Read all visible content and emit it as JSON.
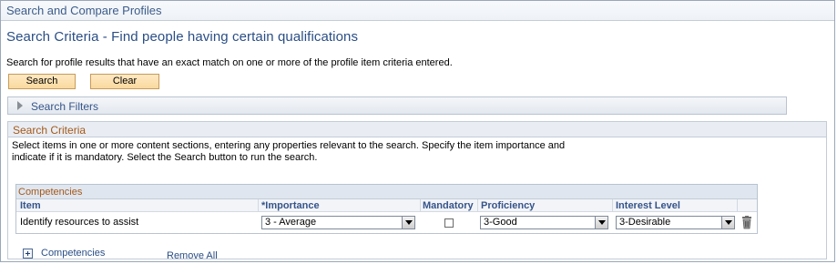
{
  "header": {
    "title": "Search and Compare Profiles"
  },
  "page": {
    "title": "Search Criteria - Find people having certain qualifications",
    "intro": "Search for profile results that have an exact match on one or more of the profile item criteria entered."
  },
  "buttons": {
    "search": "Search",
    "clear": "Clear"
  },
  "filters": {
    "label": "Search Filters",
    "expanded": false
  },
  "criteria": {
    "title": "Search Criteria",
    "description_line1": "Select items in one or more content sections, entering any properties relevant to the search. Specify the item importance and",
    "description_line2": "indicate if it is mandatory. Select the Search button to run the search.",
    "grid": {
      "title": "Competencies",
      "columns": {
        "item": "Item",
        "importance": "*Importance",
        "mandatory": "Mandatory",
        "proficiency": "Proficiency",
        "interest": "Interest Level"
      },
      "rows": [
        {
          "item": "Identify resources to assist",
          "importance": "3 - Average",
          "mandatory": false,
          "proficiency": "3-Good",
          "interest": "3-Desirable"
        }
      ]
    },
    "add_label": "Competencies",
    "remove_all": "Remove All"
  },
  "colors": {
    "title_blue": "#2a4e86",
    "section_orange": "#a4591a",
    "button_fill": "#f9d99d"
  },
  "icons": [
    "expand-triangle-icon",
    "delete-trash-icon",
    "add-plus-icon",
    "dropdown-arrow-icon"
  ]
}
